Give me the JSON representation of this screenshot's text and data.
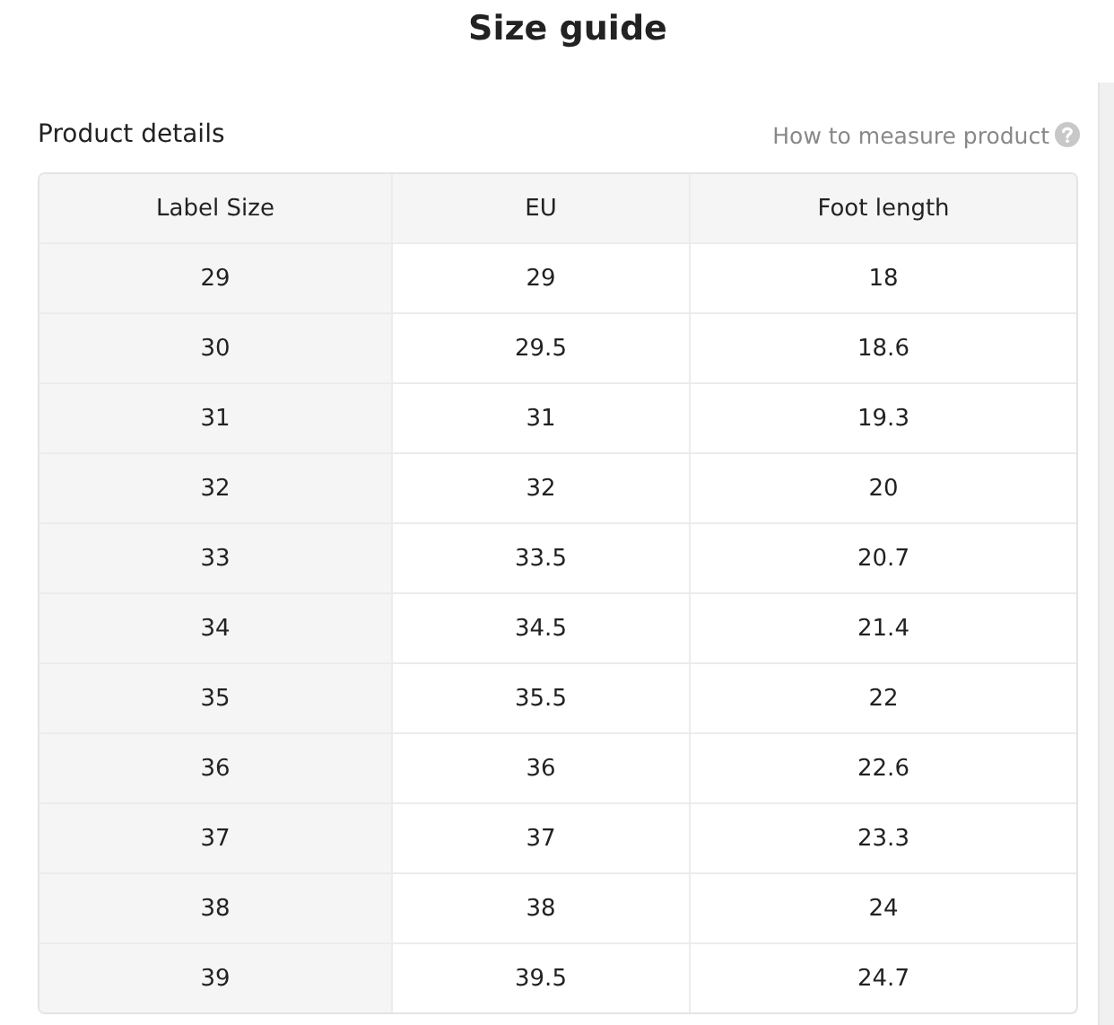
{
  "title": "Size guide",
  "section": {
    "title": "Product details",
    "help_link": "How to measure product"
  },
  "table": {
    "columns": [
      "Label Size",
      "EU",
      "Foot length"
    ],
    "rows": [
      [
        "29",
        "29",
        "18"
      ],
      [
        "30",
        "29.5",
        "18.6"
      ],
      [
        "31",
        "31",
        "19.3"
      ],
      [
        "32",
        "32",
        "20"
      ],
      [
        "33",
        "33.5",
        "20.7"
      ],
      [
        "34",
        "34.5",
        "21.4"
      ],
      [
        "35",
        "35.5",
        "22"
      ],
      [
        "36",
        "36",
        "22.6"
      ],
      [
        "37",
        "37",
        "23.3"
      ],
      [
        "38",
        "38",
        "24"
      ],
      [
        "39",
        "39.5",
        "24.7"
      ]
    ]
  }
}
